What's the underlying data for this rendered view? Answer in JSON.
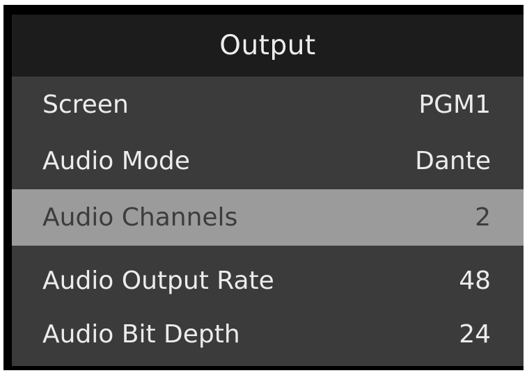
{
  "menu": {
    "title": "Output",
    "selected_index": 2,
    "items": [
      {
        "label": "Screen",
        "value": "PGM1"
      },
      {
        "label": "Audio Mode",
        "value": "Dante"
      },
      {
        "label": "Audio Channels",
        "value": "2"
      },
      {
        "label": "Audio Output Rate",
        "value": "48"
      },
      {
        "label": "Audio Bit Depth",
        "value": "24"
      }
    ]
  },
  "colors": {
    "header_bg": "#1c1c1c",
    "panel_bg": "#3b3b3b",
    "selected_bg": "#9b9b9b",
    "text": "#ececec",
    "selected_text": "#3c3c3c"
  }
}
